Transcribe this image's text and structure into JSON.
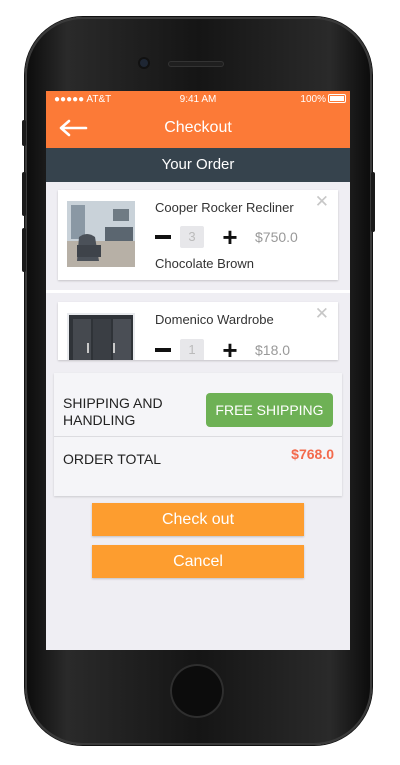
{
  "status_bar": {
    "carrier": "●●●●● AT&T",
    "time": "9:41 AM",
    "battery": "100%"
  },
  "header": {
    "title": "Checkout",
    "back_icon": "arrow-left-icon"
  },
  "section": {
    "title": "Your Order"
  },
  "cart": {
    "items": [
      {
        "name": "Cooper Rocker Recliner",
        "quantity": "3",
        "price": "$750.0",
        "color": "Chocolate Brown"
      },
      {
        "name": "Domenico Wardrobe",
        "quantity": "1",
        "price": "$18.0"
      }
    ]
  },
  "summary": {
    "shipping_label": "SHIPPING AND HANDLING",
    "shipping_value": "FREE SHIPPING",
    "total_label": "ORDER TOTAL",
    "total_value": "$768.0"
  },
  "actions": {
    "checkout": "Check out",
    "cancel": "Cancel"
  },
  "colors": {
    "brand": "#fc7a37",
    "section_bar": "#36434d",
    "button": "#fd9d2f",
    "free_shipping": "#6eb155",
    "total": "#f36a4c"
  }
}
